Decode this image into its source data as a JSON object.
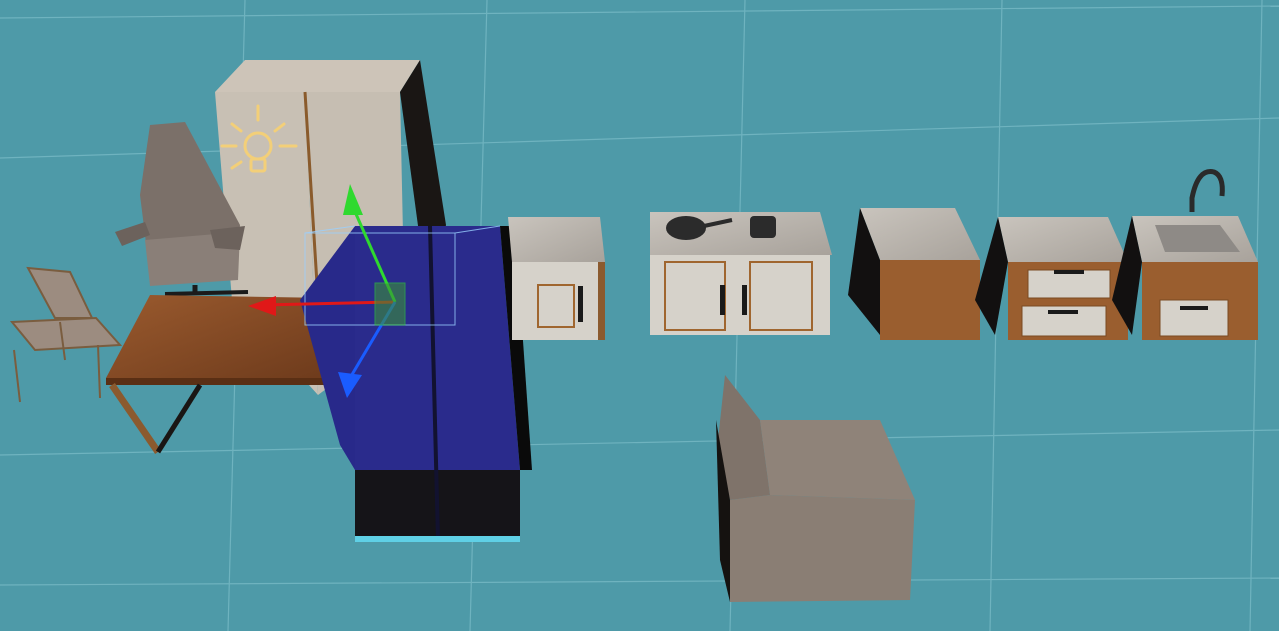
{
  "scene": {
    "background_color": "#4e9aa8",
    "grid_line_color": "#6fb3bf",
    "objects": [
      {
        "name": "office-chair",
        "icon": "office-chair"
      },
      {
        "name": "dining-chair",
        "icon": "chair"
      },
      {
        "name": "wooden-table",
        "icon": "table"
      },
      {
        "name": "wardrobe",
        "icon": "wardrobe"
      },
      {
        "name": "refrigerator-selected",
        "icon": "refrigerator",
        "selected": true,
        "selection_color": "#2a2b8c"
      },
      {
        "name": "base-cabinet-double-door",
        "icon": "cabinet"
      },
      {
        "name": "stove-cabinet",
        "icon": "stove"
      },
      {
        "name": "corner-cabinet",
        "icon": "cabinet"
      },
      {
        "name": "drawer-cabinet",
        "icon": "drawers"
      },
      {
        "name": "sink-cabinet",
        "icon": "sink"
      },
      {
        "name": "armchair",
        "icon": "armchair"
      }
    ],
    "gizmo": {
      "x_axis_color": "#e01818",
      "y_axis_color": "#2fd92f",
      "z_axis_color": "#1a5cff"
    },
    "light_icon": {
      "icon": "lightbulb-icon",
      "color": "#f3cf78"
    }
  }
}
